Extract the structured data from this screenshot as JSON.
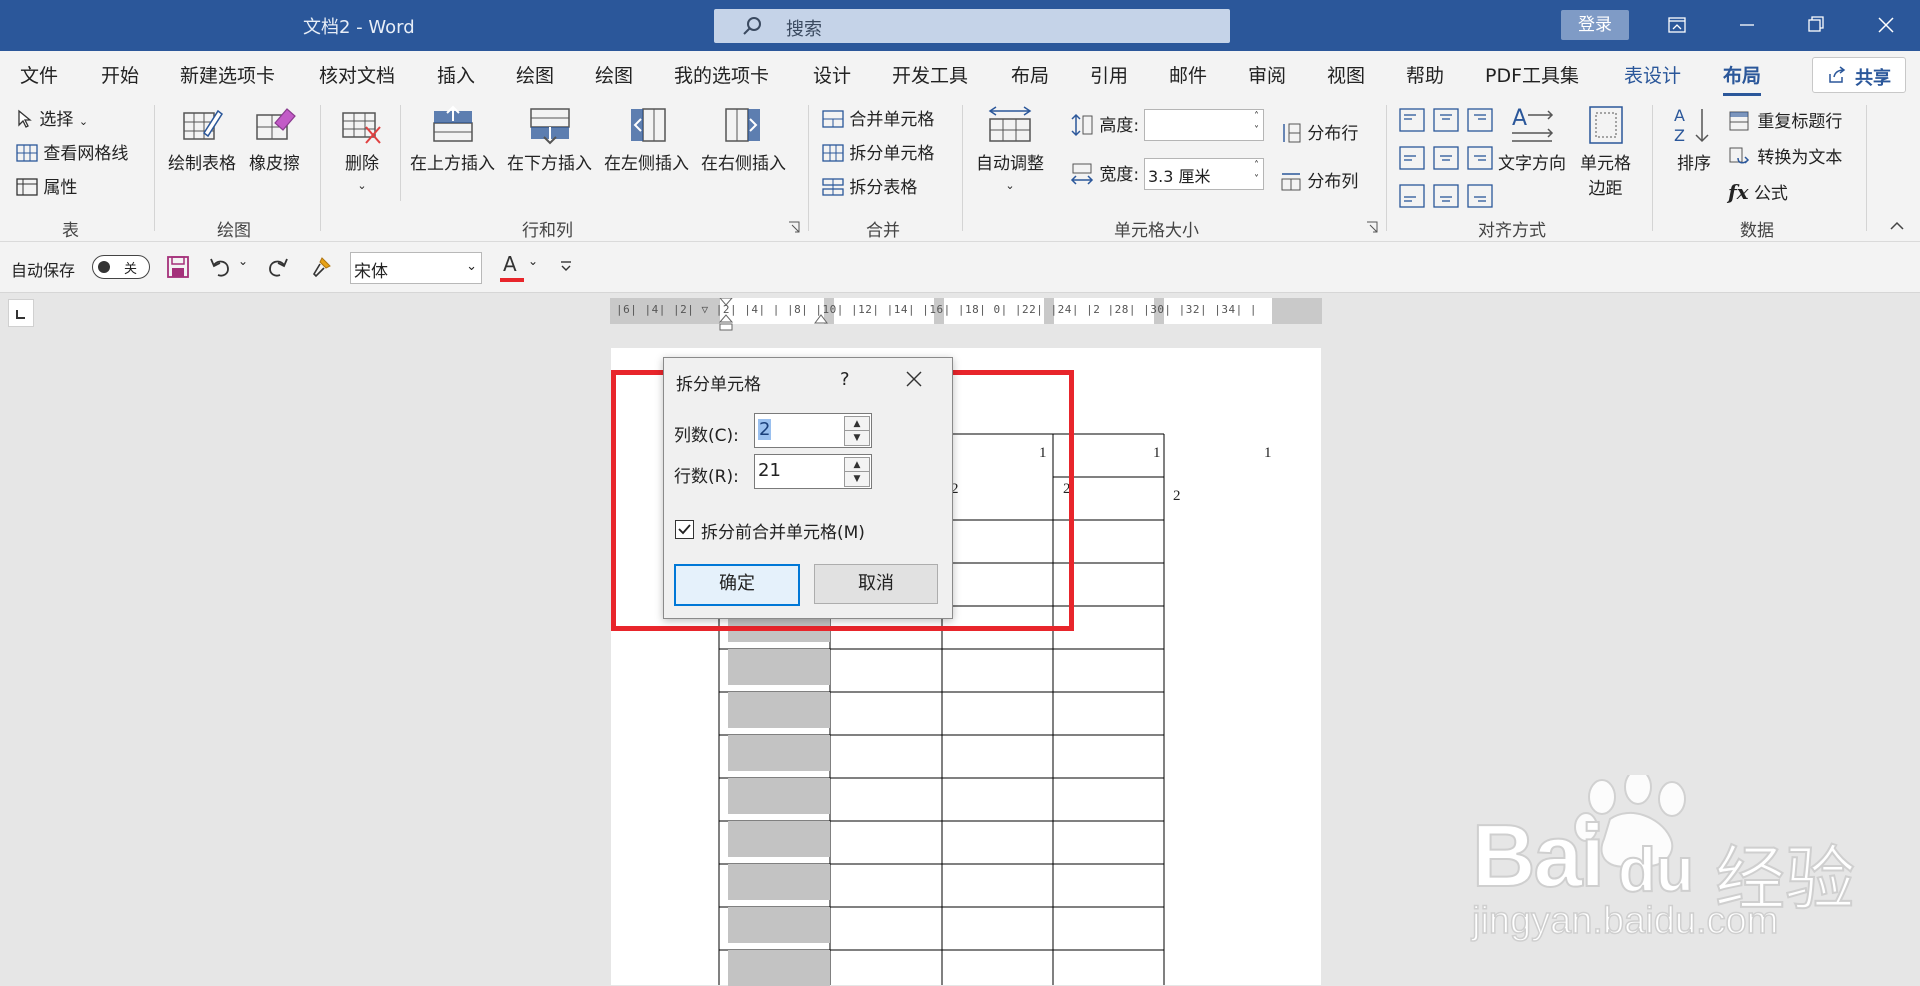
{
  "window": {
    "title": "文档2  -  Word",
    "search_placeholder": "搜索",
    "login_label": "登录"
  },
  "tabs": [
    {
      "label": "文件"
    },
    {
      "label": "开始"
    },
    {
      "label": "新建选项卡"
    },
    {
      "label": "核对文档"
    },
    {
      "label": "插入"
    },
    {
      "label": "绘图"
    },
    {
      "label": "绘图"
    },
    {
      "label": "我的选项卡"
    },
    {
      "label": "设计"
    },
    {
      "label": "开发工具"
    },
    {
      "label": "布局"
    },
    {
      "label": "引用"
    },
    {
      "label": "邮件"
    },
    {
      "label": "审阅"
    },
    {
      "label": "视图"
    },
    {
      "label": "帮助"
    },
    {
      "label": "PDF工具集"
    },
    {
      "label": "表设计"
    },
    {
      "label": "布局"
    }
  ],
  "share_label": "共享",
  "ribbon": {
    "table": {
      "select": "选择",
      "gridlines": "查看网格线",
      "properties": "属性",
      "group": "表"
    },
    "draw": {
      "draw_table": "绘制表格",
      "eraser": "橡皮擦",
      "group": "绘图"
    },
    "rows_cols": {
      "delete": "删除",
      "insert_above": "在上方插入",
      "insert_below": "在下方插入",
      "insert_left": "在左侧插入",
      "insert_right": "在右侧插入",
      "group": "行和列"
    },
    "merge": {
      "merge_cells": "合并单元格",
      "split_cells": "拆分单元格",
      "split_table": "拆分表格",
      "group": "合并"
    },
    "cell_size": {
      "autofit": "自动调整",
      "height_label": "高度:",
      "height_value": "",
      "width_label": "宽度:",
      "width_value": "3.3 厘米",
      "distribute_rows": "分布行",
      "distribute_cols": "分布列",
      "group": "单元格大小"
    },
    "alignment": {
      "text_direction": "文字方向",
      "cell_margins_1": "单元格",
      "cell_margins_2": "边距",
      "group": "对齐方式"
    },
    "data": {
      "sort": "排序",
      "repeat_header": "重复标题行",
      "convert_text": "转换为文本",
      "formula": "公式",
      "group": "数据"
    }
  },
  "qat": {
    "autosave": "自动保存",
    "toggle_state": "关",
    "font": "宋体"
  },
  "ruler": {
    "text": "|6| |4| |2|  ▽  |2| |4| |  |8| |10| |12| |14| |16| |18|  0| |22| |24| |2  |28| |30| |32| |34| |"
  },
  "table_numbers": {
    "row1": [
      "1",
      "1",
      "1"
    ],
    "row2": [
      "2",
      "2",
      "2"
    ]
  },
  "dialog": {
    "title": "拆分单元格",
    "help": "?",
    "cols_label": "列数(C):",
    "cols_value": "2",
    "rows_label": "行数(R):",
    "rows_value": "21",
    "merge_before_split": "拆分前合并单元格(M)",
    "merge_checked": true,
    "ok": "确定",
    "cancel": "取消"
  },
  "watermark": {
    "brand": "Bai",
    "brand2": "du",
    "cn": "经验",
    "url": "jingyan.baidu.com"
  },
  "colors": {
    "word_blue": "#2b579a",
    "highlight_red": "#e8252b",
    "select_blue": "#9ac0ef"
  }
}
